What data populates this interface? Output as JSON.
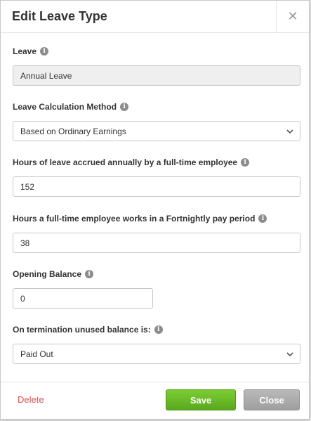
{
  "modal": {
    "title": "Edit Leave Type",
    "close_icon": "close-icon"
  },
  "fields": {
    "leave": {
      "label": "Leave",
      "value": "Annual Leave"
    },
    "calc_method": {
      "label": "Leave Calculation Method",
      "value": "Based on Ordinary Earnings"
    },
    "hours_accrued": {
      "label": "Hours of leave accrued annually by a full-time employee",
      "value": "152"
    },
    "hours_worked": {
      "label": "Hours a full-time employee works in a Fortnightly pay period",
      "value": "38"
    },
    "opening_balance": {
      "label": "Opening Balance",
      "value": "0"
    },
    "termination": {
      "label": "On termination unused balance is:",
      "value": "Paid Out"
    }
  },
  "footer": {
    "delete_label": "Delete",
    "save_label": "Save",
    "close_label": "Close"
  },
  "colors": {
    "save": "#66b827",
    "close": "#acacac",
    "delete": "#d9534f"
  }
}
